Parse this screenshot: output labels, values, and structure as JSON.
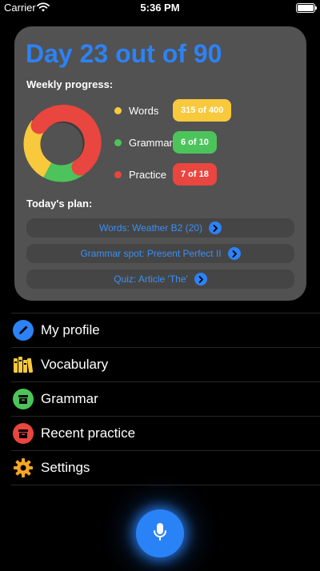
{
  "status_bar": {
    "carrier": "Carrier",
    "time": "5:36 PM"
  },
  "card": {
    "title": "Day 23 out of 90",
    "weekly_label": "Weekly progress:",
    "legend": [
      {
        "label": "Words",
        "value": "315 of 400",
        "color": "#f8c93c"
      },
      {
        "label": "Grammar",
        "value": "6 of 10",
        "color": "#4cc45b"
      },
      {
        "label": "Practice",
        "value": "7 of 18",
        "color": "#e8463f"
      }
    ],
    "plan_label": "Today's plan:",
    "plan_items": [
      "Words: Weather B2 (20)",
      "Grammar spot: Present Perfect II",
      "Quiz: Article 'The'"
    ]
  },
  "menu": [
    {
      "label": "My profile",
      "icon": "pencil-icon",
      "color": "#2c82f6"
    },
    {
      "label": "Vocabulary",
      "icon": "books-icon",
      "color": "#f8c93c"
    },
    {
      "label": "Grammar",
      "icon": "archive-box-icon",
      "color": "#4cc45b"
    },
    {
      "label": "Recent practice",
      "icon": "archive-box-icon",
      "color": "#e8463f"
    },
    {
      "label": "Settings",
      "icon": "gear-icon",
      "color": "#f5a623"
    }
  ],
  "mic": {
    "icon": "microphone-icon",
    "color": "#2a83f6"
  }
}
